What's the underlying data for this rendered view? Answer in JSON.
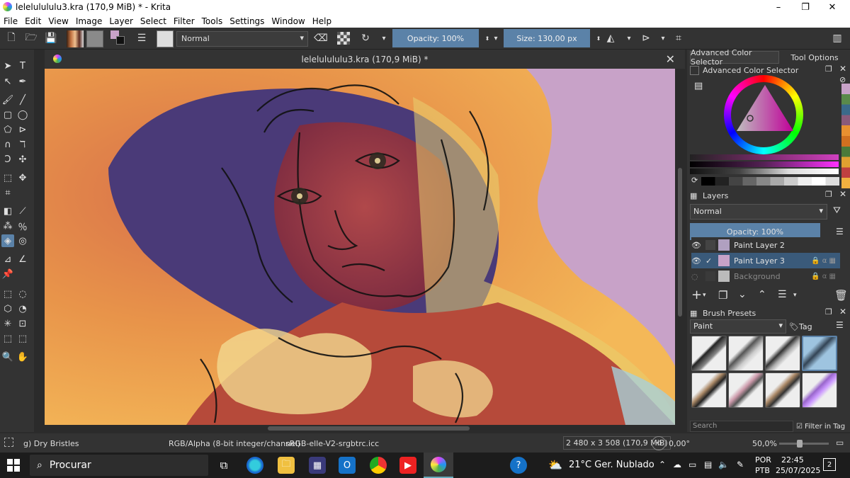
{
  "window": {
    "title": "lelelulululu3.kra (170,9 MiB) * - Krita",
    "minimize_icon": "–",
    "restore_icon": "❐",
    "close_icon": "✕"
  },
  "menu": [
    "File",
    "Edit",
    "View",
    "Image",
    "Layer",
    "Select",
    "Filter",
    "Tools",
    "Settings",
    "Window",
    "Help"
  ],
  "toolbar": {
    "blend_mode": "Normal",
    "opacity": "Opacity: 100%",
    "size": "Size: 130,00 px"
  },
  "document": {
    "tab_title": "lelelulululu3.kra (170,9 MiB) *"
  },
  "right_panel": {
    "tabs": [
      "Advanced Color Selector",
      "Tool Options"
    ],
    "color_selector_title": "Advanced Color Selector",
    "layers_title": "Layers",
    "layers_blend": "Normal",
    "layers_opacity": "Opacity:  100%",
    "layers": [
      {
        "name": "Paint Layer 2",
        "selected": false
      },
      {
        "name": "Paint Layer 3",
        "selected": true
      },
      {
        "name": "Background",
        "selected": false
      }
    ],
    "brush_presets_title": "Brush Presets",
    "brush_tag_combo": "Paint",
    "brush_tag_label": "Tag",
    "search_placeholder": "Search",
    "filter_in_tag": "Filter in Tag"
  },
  "status": {
    "brush_name": "g) Dry Bristles",
    "color_space": "RGB/Alpha (8-bit integer/channel)",
    "profile": "sRGB-elle-V2-srgbtrc.icc",
    "dimensions": "2 480 x 3 508 (170,9 MiB)",
    "rotation": "0,00°",
    "zoom": "50,0%"
  },
  "taskbar": {
    "search_label": "Procurar",
    "weather": "21°C  Ger. Nublado",
    "lang_top": "POR",
    "lang_bottom": "PTB",
    "time": "22:45",
    "date": "25/07/2025",
    "notif_count": "2"
  },
  "colors": {
    "accent_blue": "#5b82a8",
    "panel_bg": "#333333",
    "canvas_lilac": "#c8a2c8"
  }
}
